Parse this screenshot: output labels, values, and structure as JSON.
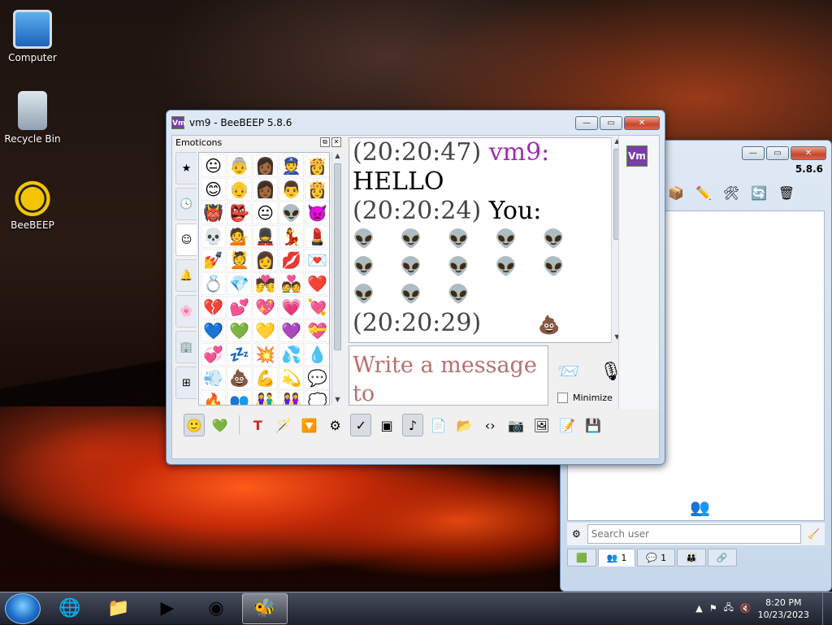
{
  "desktop": {
    "icons": [
      {
        "label": "Computer"
      },
      {
        "label": "Recycle Bin"
      },
      {
        "label": "BeeBEEP"
      }
    ]
  },
  "main_window": {
    "version": "5.8.6",
    "search_placeholder": "Search user",
    "tabs": [
      {
        "icon": "green-screen-icon",
        "count": ""
      },
      {
        "icon": "users-icon",
        "count": "1"
      },
      {
        "icon": "chat-bubbles-icon",
        "count": "1"
      },
      {
        "icon": "groups-icon",
        "count": ""
      },
      {
        "icon": "share-icon",
        "count": ""
      }
    ]
  },
  "chat_window": {
    "title": "vm9 - BeeBEEP 5.8.6",
    "badge": "Vm",
    "emoticons_panel_title": "Emoticons",
    "emoticons": [
      "😐",
      "👵",
      "👩🏾",
      "👮",
      "👸",
      "😊",
      "👴",
      "👩🏾",
      "👨",
      "👸",
      "👹",
      "👺",
      "😐",
      "👽",
      "👿",
      "💀",
      "💁",
      "💂",
      "💃",
      "💄",
      "💅",
      "💆",
      "👩",
      "💋",
      "💌",
      "💍",
      "💎",
      "💏",
      "💑",
      "❤️",
      "💔",
      "💕",
      "💖",
      "💗",
      "💘",
      "💙",
      "💚",
      "💛",
      "💜",
      "💝",
      "💞",
      "💤",
      "💥",
      "💦",
      "💧",
      "💨",
      "💩",
      "💪",
      "💫",
      "💬",
      "🔥",
      "👥",
      "👫",
      "👭",
      "💭",
      "🌟",
      "🤮"
    ],
    "messages": [
      {
        "time": "(20:20:47)",
        "author": "vm9:",
        "text": "HELLO"
      },
      {
        "time": "(20:20:24)",
        "author": "You:",
        "text": "👽 👽 👽 👽 👽 👽 👽 👽 👽 👽 👽 👽 👽"
      },
      {
        "time": "(20:20:29)",
        "author": "",
        "text": "💩"
      }
    ],
    "compose_placeholder": "Write a message to",
    "minimize_label": "Minimize"
  },
  "taskbar": {
    "time": "8:20 PM",
    "date": "10/23/2023"
  }
}
